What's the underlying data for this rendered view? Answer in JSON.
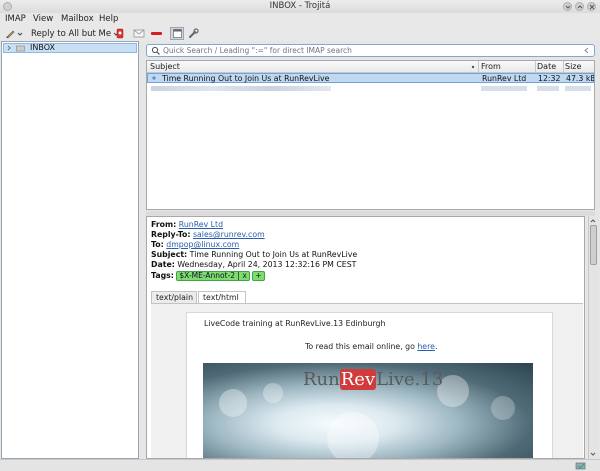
{
  "window": {
    "title": "INBOX - Trojitá"
  },
  "menu": {
    "items": [
      "IMAP",
      "View",
      "Mailbox",
      "Help"
    ]
  },
  "toolbar": {
    "reply_label": "Reply to All but Me"
  },
  "sidebar": {
    "mailbox": "INBOX"
  },
  "search": {
    "placeholder": "Quick Search / Leading \":=\" for direct IMAP search"
  },
  "message_list": {
    "columns": {
      "subject": "Subject",
      "from": "From",
      "date": "Date",
      "size": "Size"
    },
    "selected": {
      "subject": "Time Running Out to Join Us at RunRevLive",
      "from": "RunRev Ltd",
      "date": "12:32",
      "size": "47.3 kB"
    }
  },
  "message": {
    "from_label": "From:",
    "from": "RunRev Ltd",
    "reply_to_label": "Reply-To:",
    "reply_to": "sales@runrev.com",
    "to_label": "To:",
    "to": "dmpop@linux.com",
    "subject_label": "Subject:",
    "subject": "Time Running Out to Join Us at RunRevLive",
    "date_label": "Date:",
    "date": "Wednesday, April 24, 2013 12:32:16 PM CEST",
    "tags_label": "Tags:",
    "tag": "$X-ME-Annot-2",
    "tag_remove": "x",
    "tag_add": "+",
    "tabs": [
      "text/plain",
      "text/html"
    ],
    "body_line1": "LiveCode training at RunRevLive.13 Edinburgh",
    "body_line2_prefix": "To read this email online, go ",
    "body_line2_link": "here",
    "body_line2_suffix": ".",
    "banner_logo_a": "Run",
    "banner_logo_b": "Rev",
    "banner_logo_c": "Live.13"
  },
  "colors": {
    "selection": "#c0d9f2",
    "tag": "#7ddc6a",
    "link": "#2a5db0"
  }
}
